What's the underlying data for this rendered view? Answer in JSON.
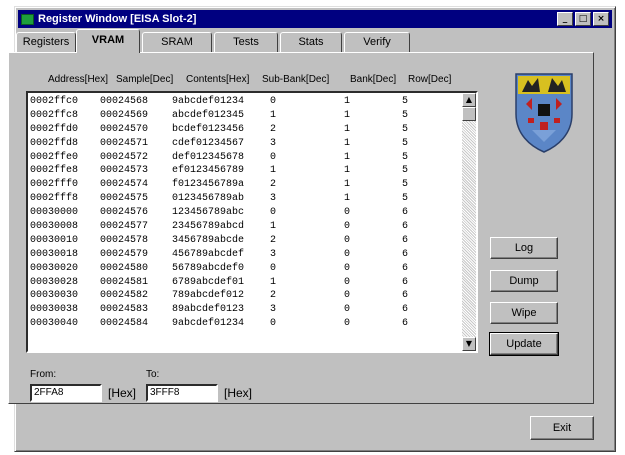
{
  "window": {
    "title": "Register Window [EISA Slot-2]",
    "controls": {
      "minimize": "_",
      "maximize": "□",
      "close": "×"
    }
  },
  "tabs": [
    {
      "label": "Registers",
      "active": false
    },
    {
      "label": "VRAM",
      "active": true
    },
    {
      "label": "SRAM",
      "active": false
    },
    {
      "label": "Tests",
      "active": false
    },
    {
      "label": "Stats",
      "active": false
    },
    {
      "label": "Verify",
      "active": false
    }
  ],
  "table": {
    "headers": [
      "Address[Hex]",
      "Sample[Dec]",
      "Contents[Hex]",
      "Sub-Bank[Dec]",
      "Bank[Dec]",
      "Row[Dec]"
    ],
    "rows": [
      [
        "0002ffc0",
        "00024568",
        "9abcdef01234",
        "0",
        "1",
        "5"
      ],
      [
        "0002ffc8",
        "00024569",
        "abcdef012345",
        "1",
        "1",
        "5"
      ],
      [
        "0002ffd0",
        "00024570",
        "bcdef0123456",
        "2",
        "1",
        "5"
      ],
      [
        "0002ffd8",
        "00024571",
        "cdef01234567",
        "3",
        "1",
        "5"
      ],
      [
        "0002ffe0",
        "00024572",
        "def012345678",
        "0",
        "1",
        "5"
      ],
      [
        "0002ffe8",
        "00024573",
        "ef0123456789",
        "1",
        "1",
        "5"
      ],
      [
        "0002fff0",
        "00024574",
        "f0123456789a",
        "2",
        "1",
        "5"
      ],
      [
        "0002fff8",
        "00024575",
        "0123456789ab",
        "3",
        "1",
        "5"
      ],
      [
        "00030000",
        "00024576",
        "123456789abc",
        "0",
        "0",
        "6"
      ],
      [
        "00030008",
        "00024577",
        "23456789abcd",
        "1",
        "0",
        "6"
      ],
      [
        "00030010",
        "00024578",
        "3456789abcde",
        "2",
        "0",
        "6"
      ],
      [
        "00030018",
        "00024579",
        "456789abcdef",
        "3",
        "0",
        "6"
      ],
      [
        "00030020",
        "00024580",
        "56789abcdef0",
        "0",
        "0",
        "6"
      ],
      [
        "00030028",
        "00024581",
        "6789abcdef01",
        "1",
        "0",
        "6"
      ],
      [
        "00030030",
        "00024582",
        "789abcdef012",
        "2",
        "0",
        "6"
      ],
      [
        "00030038",
        "00024583",
        "89abcdef0123",
        "3",
        "0",
        "6"
      ],
      [
        "00030040",
        "00024584",
        "9abcdef01234",
        "0",
        "0",
        "6"
      ]
    ]
  },
  "scrollbar": {
    "up": "▲",
    "down": "▼"
  },
  "buttons": {
    "log": "Log",
    "dump": "Dump",
    "wipe": "Wipe",
    "update": "Update",
    "exit": "Exit"
  },
  "range": {
    "from_label": "From:",
    "from_value": "2FFA8",
    "to_label": "To:",
    "to_value": "3FFF8",
    "unit": "[Hex]"
  },
  "colors": {
    "titlebar": "#000080",
    "crest_shield": "#5b86c7",
    "crest_gold": "#d8c020",
    "crest_red": "#c02020"
  }
}
